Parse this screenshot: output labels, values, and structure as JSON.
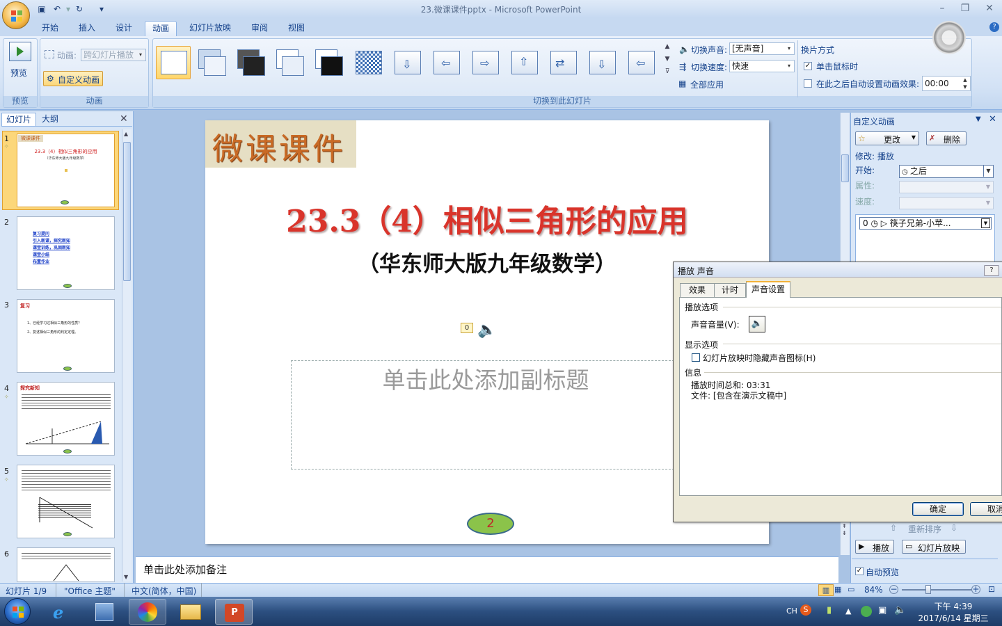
{
  "window": {
    "title": "23.微课课件pptx - Microsoft PowerPoint"
  },
  "tabs": [
    "开始",
    "插入",
    "设计",
    "动画",
    "幻灯片放映",
    "审阅",
    "视图"
  ],
  "ribbon": {
    "preview_label": "预览",
    "preview_group": "预览",
    "animation_label": "动画:",
    "animation_value": "跨幻灯片播放",
    "custom_anim_button": "自定义动画",
    "animation_group": "动画",
    "transition_group": "切换到此幻灯片",
    "sound_label": "切换声音:",
    "sound_value": "[无声音]",
    "speed_label": "切换速度:",
    "speed_value": "快速",
    "apply_all": "全部应用",
    "advance_title": "换片方式",
    "on_click": "单击鼠标时",
    "auto_after": "在此之后自动设置动画效果:",
    "auto_time": "00:00"
  },
  "leftpane": {
    "tab_slides": "幻灯片",
    "tab_outline": "大纲",
    "thumbs": [
      {
        "num": "1",
        "title": "微课课件",
        "line1": "23.3（4）相似三角形的应用",
        "line2": "（华东师大版九年级数学）"
      },
      {
        "num": "2",
        "items": [
          "复习提问",
          "引入新课，探究新知",
          "课堂训练，巩固新知",
          "课堂小结",
          "布置作业"
        ]
      },
      {
        "num": "3",
        "title": "复习",
        "items": [
          "1、已经学习过相似三角形的性质？",
          "2、复述相似三角形的判定定理。"
        ]
      },
      {
        "num": "4",
        "title": "探究新知"
      },
      {
        "num": "5"
      },
      {
        "num": "6"
      }
    ]
  },
  "slide": {
    "badge": "微课课件",
    "title": "23.3（4）相似三角形的应用",
    "subtitle": "（华东师大版九年级数学）",
    "anim_tag": "0",
    "placeholder": "单击此处添加副标题",
    "page_number": "2"
  },
  "notes": {
    "placeholder": "单击此处添加备注"
  },
  "taskpane": {
    "title": "自定义动画",
    "change": "更改",
    "delete": "删除",
    "modify_label": "修改: 播放",
    "start_label": "开始:",
    "start_value": "之后",
    "prop_label": "属性:",
    "speed_label": "速度:",
    "list_item": "0 ◷  ▷ 筷子兄弟-小苹...",
    "reorder": "重新排序",
    "play": "播放",
    "slideshow": "幻灯片放映",
    "autopreview": "自动预览"
  },
  "dialog": {
    "title": "播放 声音",
    "tabs": [
      "效果",
      "计时",
      "声音设置"
    ],
    "play_options": "播放选项",
    "volume_label": "声音音量(V):",
    "display_options": "显示选项",
    "hide_icon": "幻灯片放映时隐藏声音图标(H)",
    "info": "信息",
    "total_time": "播放时间总和:  03:31",
    "file": "文件:  [包含在演示文稿中]",
    "ok": "确定",
    "cancel": "取消"
  },
  "status": {
    "slide": "幻灯片 1/9",
    "theme": "\"Office 主题\"",
    "lang": "中文(简体，中国)",
    "zoom": "84%"
  },
  "taskbar": {
    "ime": "CH",
    "time": "下午 4:39",
    "date": "2017/6/14 星期三"
  }
}
